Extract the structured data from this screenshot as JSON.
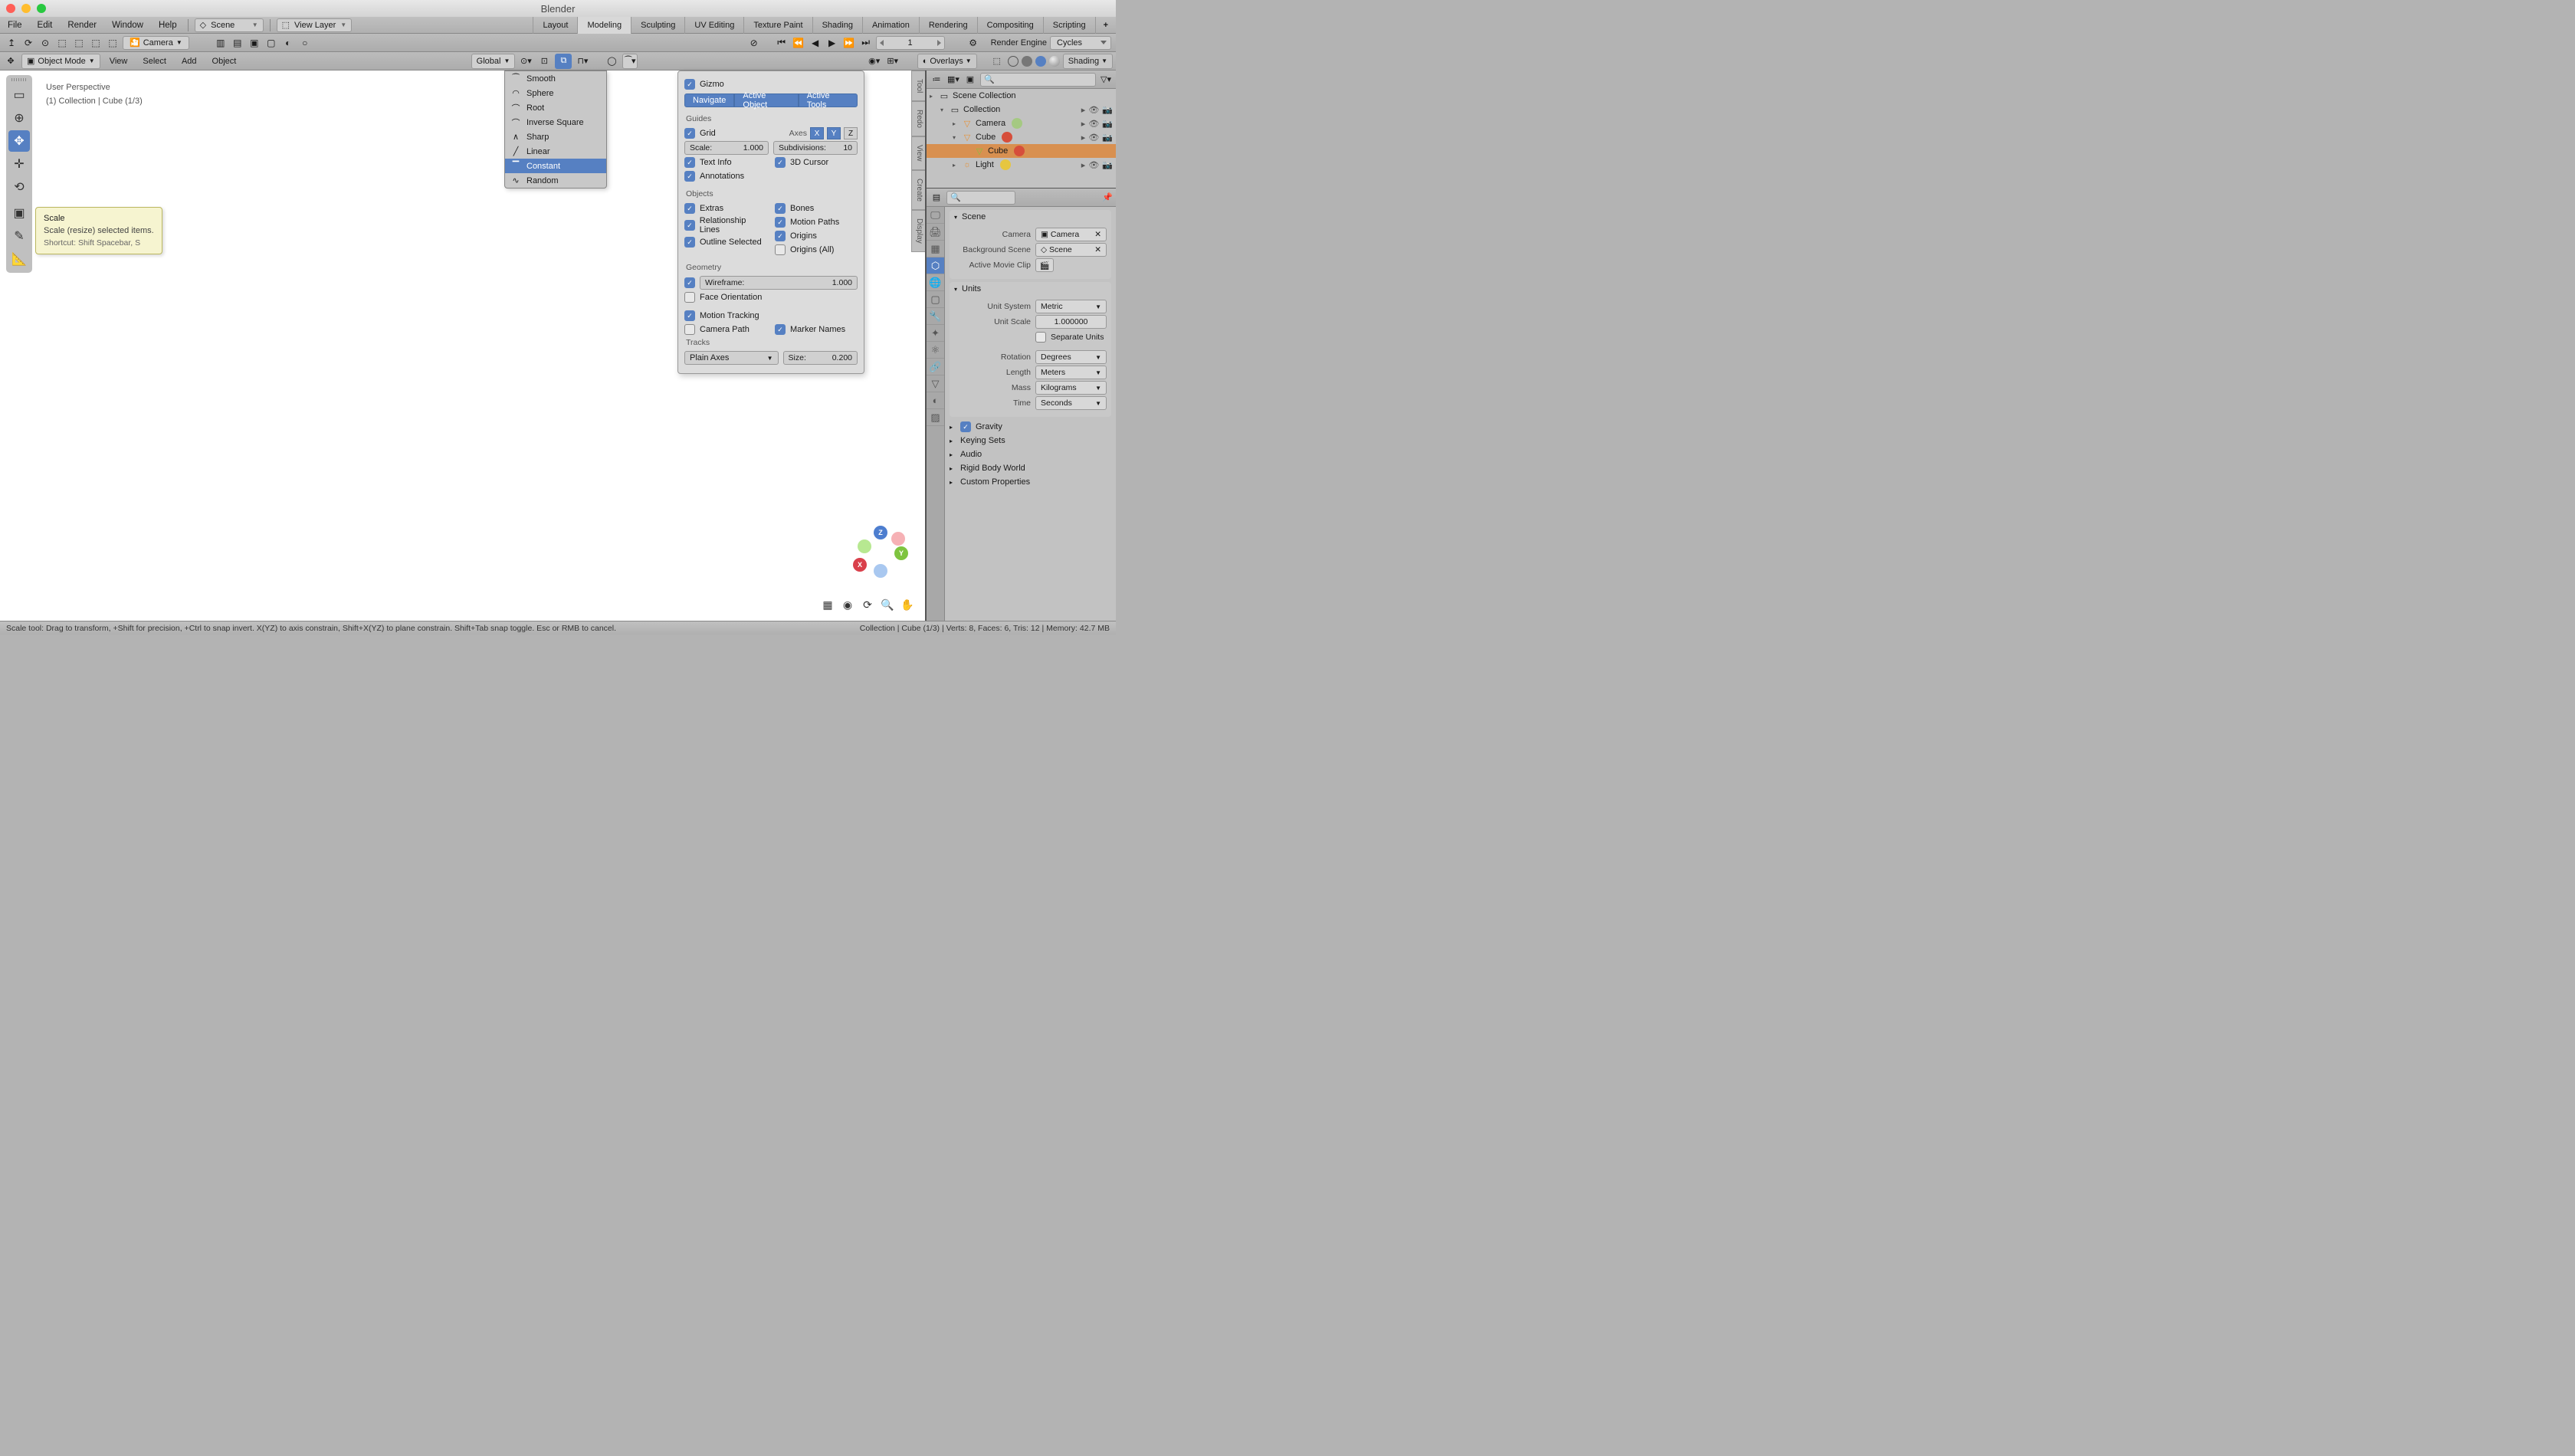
{
  "app_title": "Blender",
  "menus": [
    "File",
    "Edit",
    "Render",
    "Window",
    "Help"
  ],
  "scene_field": "Scene",
  "viewlayer_field": "View Layer",
  "workspaces": [
    "Layout",
    "Modeling",
    "Sculpting",
    "UV Editing",
    "Texture Paint",
    "Shading",
    "Animation",
    "Rendering",
    "Compositing",
    "Scripting"
  ],
  "active_workspace": "Modeling",
  "secondbar": {
    "pivot": "Camera",
    "frame": "1",
    "render_engine_label": "Render Engine",
    "render_engine": "Cycles"
  },
  "viewbar": {
    "mode": "Object Mode",
    "menus": [
      "View",
      "Select",
      "Add",
      "Object"
    ],
    "orient": "Global",
    "overlays_label": "Overlays",
    "shading_label": "Shading"
  },
  "viewinfo": {
    "line1": "User Perspective",
    "line2": "(1) Collection | Cube (1/3)"
  },
  "tooltip": {
    "title": "Scale",
    "desc": "Scale (resize) selected items.",
    "shortcut": "Shortcut: Shift Spacebar, S"
  },
  "falloff": [
    "Smooth",
    "Sphere",
    "Root",
    "Inverse Square",
    "Sharp",
    "Linear",
    "Constant",
    "Random"
  ],
  "falloff_selected": "Constant",
  "overlays": {
    "gizmo": "Gizmo",
    "nav_buttons": [
      "Navigate",
      "Active Object",
      "Active Tools"
    ],
    "guides_hdr": "Guides",
    "grid": "Grid",
    "axes_label": "Axes",
    "axes": [
      "X",
      "Y",
      "Z"
    ],
    "axes_on": [
      "X",
      "Y"
    ],
    "scale_row": {
      "label": "Scale:",
      "value": "1.000"
    },
    "subdiv_row": {
      "label": "Subdivisions:",
      "value": "10"
    },
    "textinfo": "Text Info",
    "cursor3d": "3D Cursor",
    "annotations": "Annotations",
    "objects_hdr": "Objects",
    "extras": "Extras",
    "bones": "Bones",
    "rel": "Relationship Lines",
    "motion": "Motion Paths",
    "outline": "Outline Selected",
    "origins": "Origins",
    "originsall": "Origins (All)",
    "geom_hdr": "Geometry",
    "wire_row": {
      "label": "Wireframe:",
      "value": "1.000"
    },
    "faceori": "Face Orientation",
    "motiontrack": "Motion Tracking",
    "campath": "Camera Path",
    "marker": "Marker Names",
    "tracks_label": "Tracks",
    "tracks_sel": "Plain Axes",
    "size_label": "Size:",
    "size_val": "0.200"
  },
  "vtabs": [
    "Tool",
    "Redo",
    "View",
    "Create",
    "Display"
  ],
  "outliner": {
    "root": "Scene Collection",
    "coll": "Collection",
    "camera": "Camera",
    "cube": "Cube",
    "cube2": "Cube",
    "light": "Light"
  },
  "properties": {
    "scene_panel": "Scene",
    "camera_label": "Camera",
    "camera_val": "Camera",
    "bgscene_label": "Background Scene",
    "bgscene_val": "Scene",
    "clip_label": "Active Movie Clip",
    "units_panel": "Units",
    "unit_system_label": "Unit System",
    "unit_system": "Metric",
    "unit_scale_label": "Unit Scale",
    "unit_scale": "1.000000",
    "separate": "Separate Units",
    "rotation_label": "Rotation",
    "rotation": "Degrees",
    "length_label": "Length",
    "length": "Meters",
    "mass_label": "Mass",
    "mass": "Kilograms",
    "time_label": "Time",
    "time": "Seconds",
    "gravity": "Gravity",
    "keying": "Keying Sets",
    "audio": "Audio",
    "rigid": "Rigid Body World",
    "custom": "Custom Properties"
  },
  "status_left": "Scale tool: Drag to transform, +Shift for precision, +Ctrl to snap invert. X(YZ) to axis constrain, Shift+X(YZ) to plane constrain. Shift+Tab snap toggle. Esc or RMB to cancel.",
  "status_right": "Collection | Cube (1/3) | Verts: 8, Faces: 6, Tris: 12 | Memory: 42.7 MB"
}
